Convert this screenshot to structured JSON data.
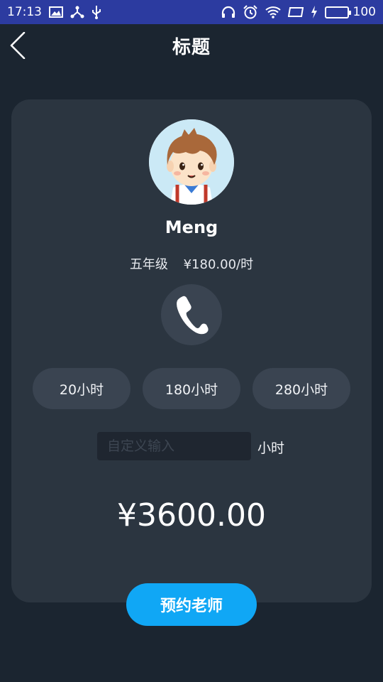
{
  "status_bar": {
    "time": "17:13",
    "battery": "100",
    "icons": [
      "image-icon",
      "usb-share-icon",
      "usb-icon",
      "headphones-icon",
      "alarm-icon",
      "wifi-icon",
      "screen-icon",
      "charging-icon",
      "battery-icon"
    ]
  },
  "nav": {
    "title": "标题",
    "back_icon": "chevron-left-icon"
  },
  "teacher": {
    "name": "Meng",
    "grade": "五年级",
    "rate": "¥180.00/时",
    "avatar_icon": "cartoon-boy-avatar"
  },
  "call_icon": "phone-icon",
  "hour_options": [
    "20小时",
    "180小时",
    "280小时"
  ],
  "custom_hours": {
    "placeholder": "自定义输入",
    "value": "",
    "unit": "小时"
  },
  "total_price": "¥3600.00",
  "book_button": "预约老师",
  "colors": {
    "background": "#1b2530",
    "card": "#2b3540",
    "pill": "#3a4451",
    "status_bar": "#2c3ba0",
    "accent": "#10a7f5"
  }
}
